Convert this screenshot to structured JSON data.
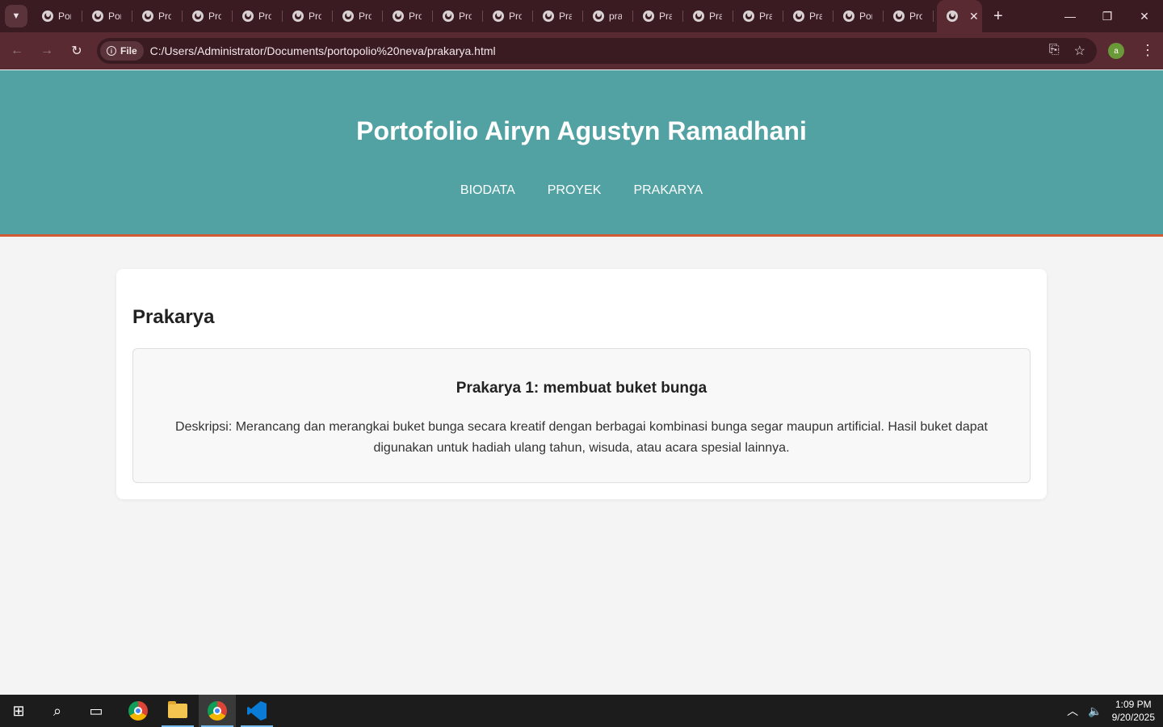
{
  "browser": {
    "tabs": [
      {
        "label": "Por"
      },
      {
        "label": "Por"
      },
      {
        "label": "Pro"
      },
      {
        "label": "Pro"
      },
      {
        "label": "Pro"
      },
      {
        "label": "Pro"
      },
      {
        "label": "Pro"
      },
      {
        "label": "Pro"
      },
      {
        "label": "Pro"
      },
      {
        "label": "Pro"
      },
      {
        "label": "Pra"
      },
      {
        "label": "pra"
      },
      {
        "label": "Pra"
      },
      {
        "label": "Pra"
      },
      {
        "label": "Pra"
      },
      {
        "label": "Pra"
      },
      {
        "label": "Por"
      },
      {
        "label": "Pro"
      }
    ],
    "site_info_label": "File",
    "url": "C:/Users/Administrator/Documents/portopolio%20neva/prakarya.html",
    "profile_initial": "a"
  },
  "site": {
    "title": "Portofolio Airyn Agustyn Ramadhani",
    "nav": [
      "BIODATA",
      "PROYEK",
      "PRAKARYA"
    ],
    "section_title": "Prakarya",
    "item": {
      "title": "Prakarya 1: membuat buket bunga",
      "description": "Deskripsi: Merancang dan merangkai buket bunga secara kreatif dengan berbagai kombinasi bunga segar maupun artificial. Hasil buket dapat digunakan untuk hadiah ulang tahun, wisuda, atau acara spesial lainnya."
    }
  },
  "taskbar": {
    "time": "1:09 PM",
    "date": "9/20/2025"
  },
  "colors": {
    "header": "#52a2a3",
    "header_border": "#d35b34",
    "chrome_frame": "#3a1b22",
    "chrome_toolbar": "#5a2a33"
  }
}
